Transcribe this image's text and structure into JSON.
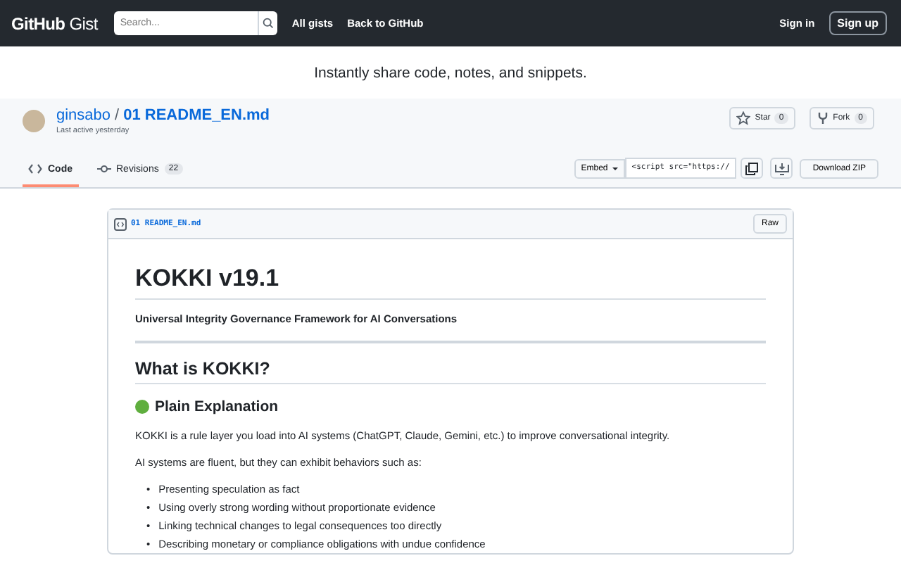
{
  "header": {
    "logo": {
      "brand": "GitHub",
      "product": "Gist"
    },
    "search": {
      "placeholder": "Search..."
    },
    "nav": [
      "All gists",
      "Back to GitHub"
    ],
    "sign_in": "Sign in",
    "sign_up": "Sign up"
  },
  "tagline": "Instantly share code, notes, and snippets.",
  "gist": {
    "owner": "ginsabo",
    "separator": "/",
    "filename": "01 README_EN.md",
    "last_active": "Last active yesterday",
    "star": {
      "label": "Star",
      "count": "0"
    },
    "fork": {
      "label": "Fork",
      "count": "0"
    },
    "tabs": [
      {
        "label": "Code",
        "selected": true
      },
      {
        "label": "Revisions",
        "count": "22",
        "selected": false
      }
    ],
    "embed": {
      "label": "Embed",
      "value": "<script src=\"https://"
    },
    "download": "Download ZIP"
  },
  "file": {
    "name": "01 README_EN.md",
    "raw": "Raw",
    "content": [
      {
        "kind": "h1",
        "text": "KOKKI v19.1"
      },
      {
        "kind": "strong",
        "text": "Universal Integrity Governance Framework for AI Conversations"
      },
      {
        "kind": "hr"
      },
      {
        "kind": "h2",
        "text": "What is KOKKI?"
      },
      {
        "kind": "h3",
        "text": "Plain Explanation",
        "color": "#5fae3e"
      },
      {
        "kind": "p",
        "text": "KOKKI is a rule layer you load into AI systems (ChatGPT, Claude, Gemini, etc.) to improve conversational integrity."
      },
      {
        "kind": "p",
        "text": "AI systems are fluent, but they can exhibit behaviors such as:"
      },
      {
        "kind": "ul",
        "marker": "•",
        "items": [
          "Presenting speculation as fact",
          "Using overly strong wording without proportionate evidence",
          "Linking technical changes to legal consequences too directly",
          "Describing monetary or compliance obligations with undue confidence"
        ]
      }
    ]
  }
}
